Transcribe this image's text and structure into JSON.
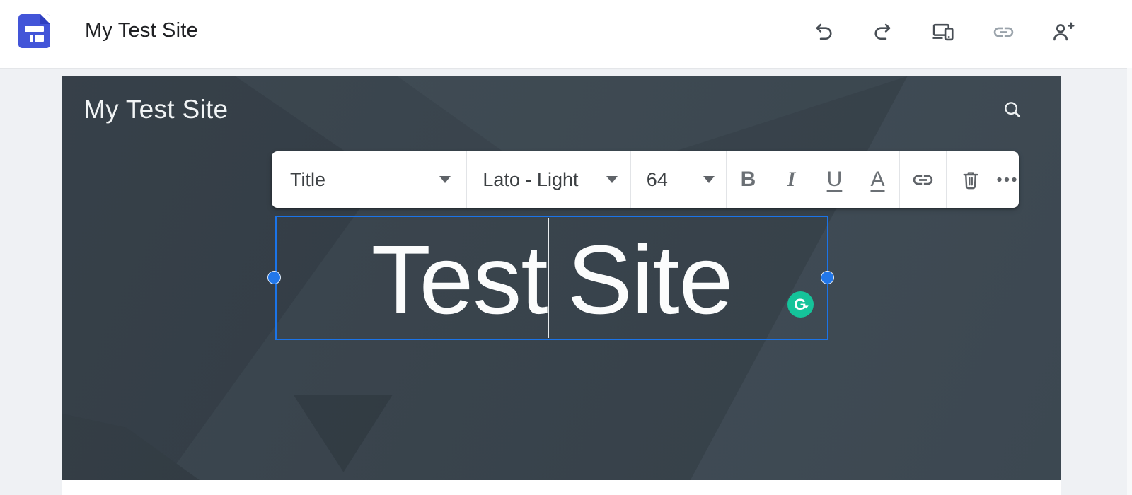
{
  "app_header": {
    "title": "My Test Site",
    "logo_icon": "google-sites-logo",
    "action_icons": [
      "undo-icon",
      "redo-icon",
      "device-preview-icon",
      "copy-link-icon",
      "add-people-icon"
    ]
  },
  "banner": {
    "site_title": "My Test Site",
    "search_icon": "search-icon"
  },
  "toolbar": {
    "style_value": "Title",
    "font_value": "Lato - Light",
    "size_value": "64",
    "bold_label": "B",
    "italic_label": "I",
    "underline_label": "U",
    "text_color_label": "A",
    "icons": [
      "insert-link-icon",
      "delete-icon",
      "more-options-icon"
    ]
  },
  "textbox": {
    "full_text": "Test Site",
    "before_caret": "Test",
    "after_caret": "Site",
    "grammarly_badge_letter": "G"
  },
  "colors": {
    "selection_blue": "#1b74e8",
    "grammarly_green": "#15c39a",
    "banner_base": "#38434c",
    "header_icon_gray": "#474d54",
    "toolbar_icon_gray": "#5f6368",
    "disabled_icon_gray": "#9aa3ab"
  }
}
